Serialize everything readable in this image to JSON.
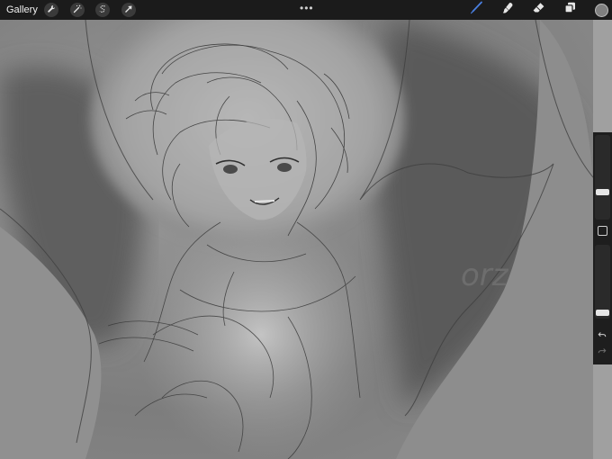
{
  "topbar": {
    "gallery_label": "Gallery",
    "left_tools": [
      "wrench-icon",
      "magic-wand-icon",
      "selection-icon",
      "transform-arrow-icon"
    ],
    "more_label": "•••",
    "right_tools": [
      "brush-icon",
      "smudge-icon",
      "eraser-icon",
      "layers-icon"
    ],
    "active_tool": "brush-icon",
    "active_color": "#4a7fe0",
    "current_color": "#808080"
  },
  "canvas": {
    "signature_text": "orz"
  },
  "sidebar": {
    "undo_icon": "undo-icon",
    "redo_icon": "redo-icon"
  }
}
